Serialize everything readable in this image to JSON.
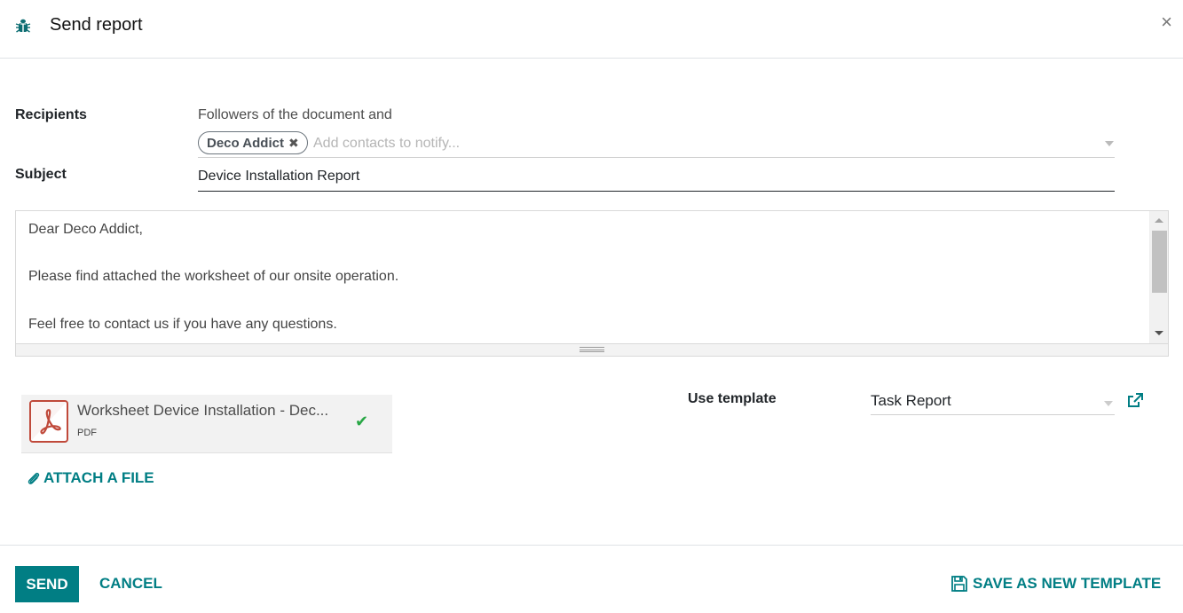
{
  "dialog": {
    "title": "Send report",
    "title_icon": "bug-icon",
    "close_icon": "close-icon",
    "close_glyph": "×"
  },
  "form": {
    "recipients": {
      "label": "Recipients",
      "followers_text": "Followers of the document and",
      "tags": [
        {
          "label": "Deco Addict",
          "remove_glyph": "✖"
        }
      ],
      "input_value": "",
      "placeholder": "Add contacts to notify..."
    },
    "subject": {
      "label": "Subject",
      "value": "Device Installation Report"
    },
    "body": {
      "paragraphs": [
        "Dear Deco Addict,",
        "",
        "Please find attached the worksheet of our onsite operation.",
        "",
        "Feel free to contact us if you have any questions."
      ]
    },
    "attachments": [
      {
        "name": "Worksheet Device Installation - Dec...",
        "type": "PDF",
        "icon": "pdf-file-icon",
        "status_icon": "check-icon",
        "status_glyph": "✔"
      }
    ],
    "attach_file_label": "ATTACH A FILE",
    "template": {
      "label": "Use template",
      "value": "Task Report"
    }
  },
  "footer": {
    "send_label": "SEND",
    "cancel_label": "CANCEL",
    "save_template_label": "SAVE AS NEW TEMPLATE"
  },
  "colors": {
    "primary": "#017e84",
    "success": "#28a745",
    "pdf_red": "#c0493a"
  }
}
